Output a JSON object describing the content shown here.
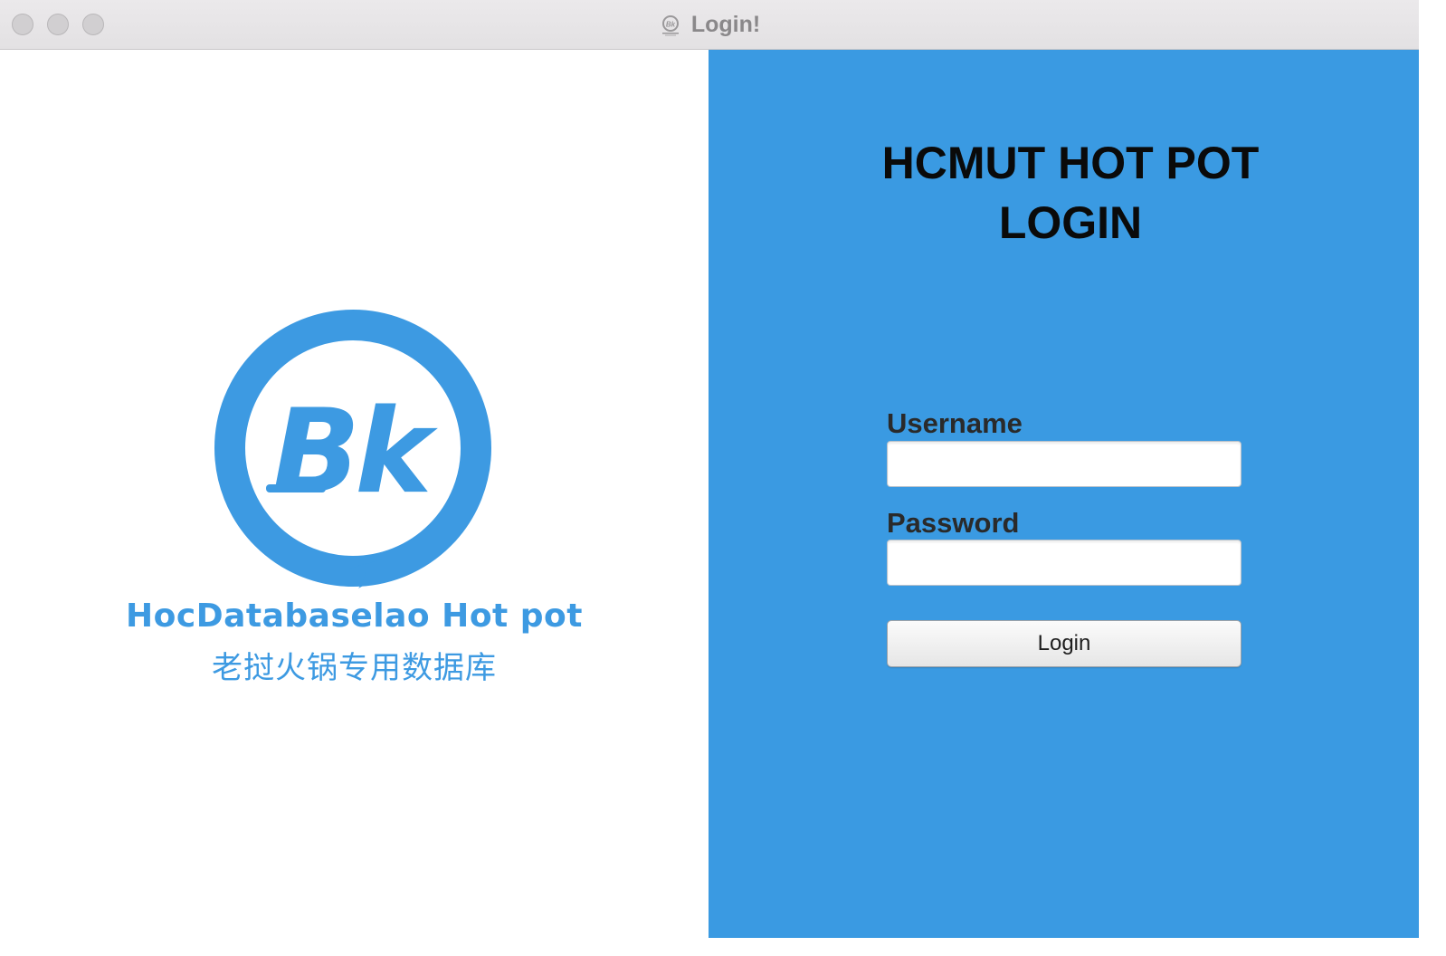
{
  "window": {
    "title": "Login!",
    "title_icon": "bk-logo-icon"
  },
  "titlebar_buttons": [
    "close",
    "minimize",
    "zoom"
  ],
  "left_panel": {
    "logo": {
      "icon": "bk-logo-icon",
      "letters": "Bk",
      "color": "#3d9ae2"
    },
    "brand_name": "HocDatabaselao Hot pot",
    "brand_subtitle": "老挝火锅专用数据库"
  },
  "right_panel": {
    "background": "#3a9ae2",
    "heading_line1": "HCMUT HOT POT",
    "heading_line2": "LOGIN",
    "username_label": "Username",
    "username_value": "",
    "password_label": "Password",
    "password_value": "",
    "login_button_label": "Login"
  }
}
